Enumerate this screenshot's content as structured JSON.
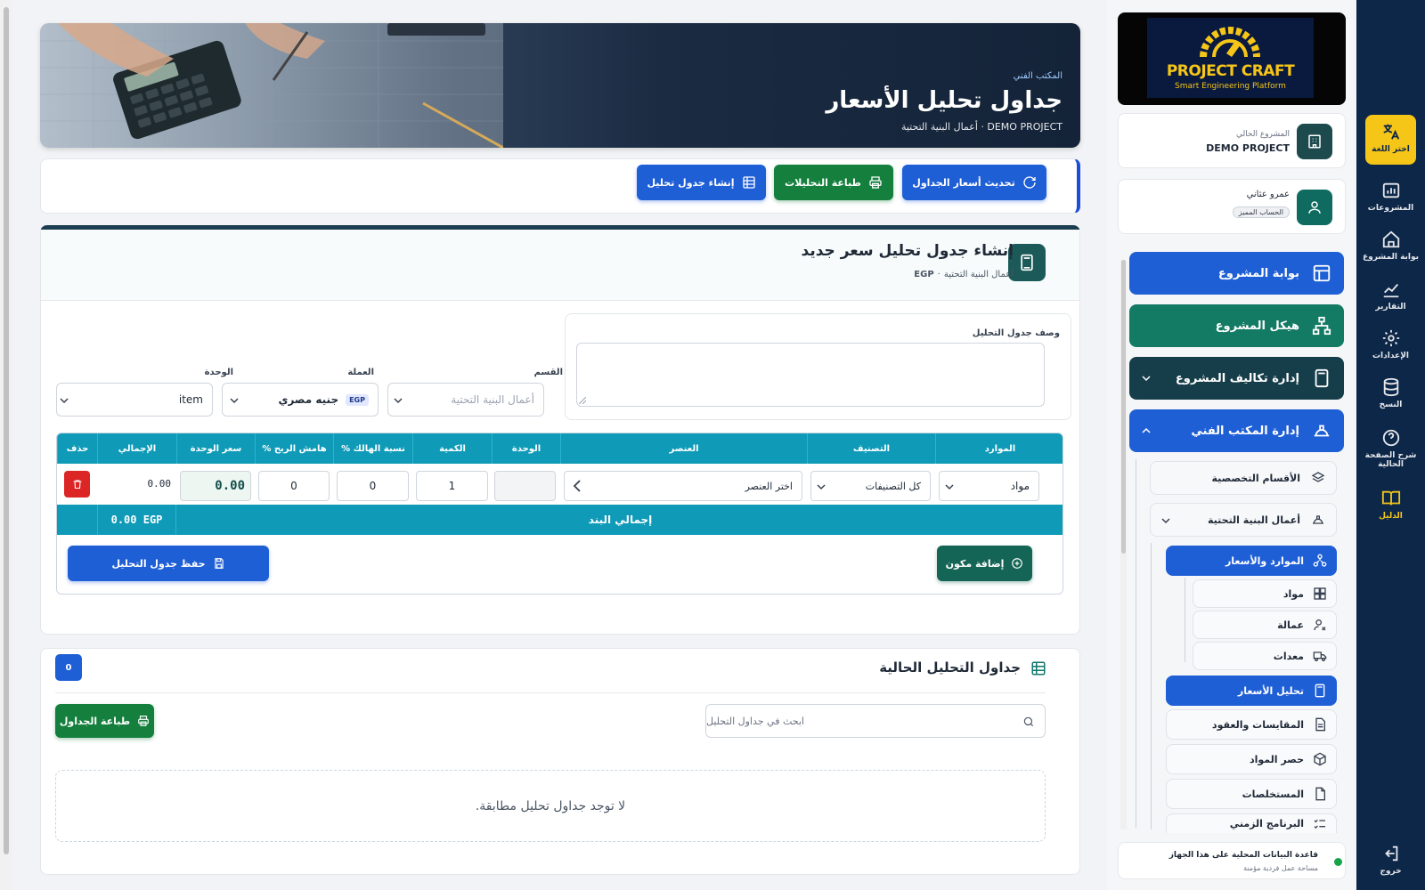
{
  "hero": {
    "crumb": "المكتب الفني",
    "title": "جداول تحليل الأسعار",
    "subtitle": "DEMO PROJECT · أعمال البنية التحتية"
  },
  "toolbar": {
    "refresh_label": "تحديث أسعار الجداول",
    "print_label": "طباعة التحليلات",
    "create_label": "إنشاء جدول تحليل"
  },
  "create": {
    "title": "إنشاء جدول تحليل سعر جديد",
    "subtitle_section": "أعمال البنية التحتية",
    "subtitle_currency": "EGP",
    "desc_label": "وصف جدول التحليل",
    "section_label": "القسم",
    "section_placeholder": "أعمال البنية التحتية",
    "currency_label": "العملة",
    "currency_value": "جنيه مصري",
    "currency_badge": "EGP",
    "unit_label": "الوحدة",
    "unit_value": "item"
  },
  "table": {
    "headers": [
      "الموارد",
      "التصنيف",
      "العنصر",
      "الوحدة",
      "الكمية",
      "نسبة الهالك %",
      "هامش الربح %",
      "سعر الوحدة",
      "الإجمالي",
      "حذف"
    ],
    "row": {
      "resource": "مواد",
      "category": "كل التصنيفات",
      "element": "اختر العنصر",
      "unit": "",
      "quantity": "1",
      "waste": "0",
      "profit": "0",
      "unit_price": "0.00",
      "total": "0.00"
    },
    "total_label": "إجمالي البند",
    "total_value": "0.00 EGP",
    "add_label": "إضافة مكون",
    "save_label": "حفظ جدول التحليل"
  },
  "list": {
    "title": "جداول التحليل الحالية",
    "count": "0",
    "search_placeholder": "ابحث في جداول التحليل",
    "print_label": "طباعة الجداول",
    "empty_text": "لا توجد جداول تحليل مطابقة."
  },
  "sidebar": {
    "logo_title": "PROJECT CRAFT",
    "logo_tagline": "Smart Engineering Platform",
    "project_caption": "المشروع الحالي",
    "project_name": "DEMO PROJECT",
    "user_name": "عمرو عثاني",
    "user_badge": "الحساب المميز",
    "nav": {
      "portal": "بوابة المشروع",
      "structure": "هيكل المشروع",
      "costs": "إدارة تكاليف المشروع",
      "tech_office": "إدارة المكتب الفني",
      "specialized": "الأقسام التخصصية",
      "infrastructure": "أعمال البنية التحتية",
      "resources": "الموارد والأسعار",
      "materials": "مواد",
      "labor": "عمالة",
      "equipment": "معدات",
      "price_analysis": "تحليل الأسعار",
      "contracts": "المقايسات والعقود",
      "material_takeoff": "حصر المواد",
      "invoices": "المستخلصات",
      "schedule": "البرنامج الزمني"
    },
    "db_title": "قاعدة البيانات المحلية على هذا الجهاز",
    "db_sub": "مساحة عمل فردية مؤمنة"
  },
  "rail": {
    "language": "اختر اللغة",
    "projects": "المشروعات",
    "portal": "بوابة المشروع",
    "reports": "التقارير",
    "settings": "الإعدادات",
    "backup": "النسخ",
    "help": "شرح الصفحة الحالية",
    "guide": "الدليل",
    "logout": "خروج"
  },
  "colors": {
    "primary_blue": "#1f5fd6",
    "green": "#15803d",
    "teal": "#0f9bb8",
    "dark_teal": "#1c3d4f",
    "navy": "#0d2748",
    "accent_yellow": "#f5c518",
    "danger": "#dc2626"
  }
}
